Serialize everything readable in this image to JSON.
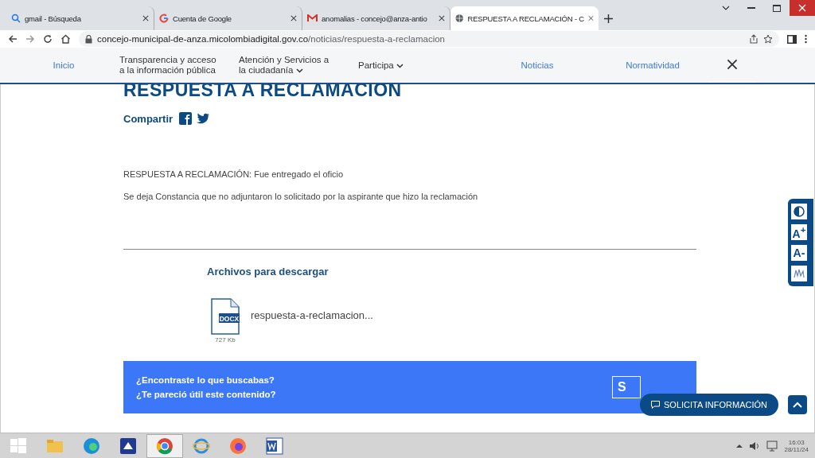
{
  "browser": {
    "tabs": [
      {
        "kind": "search",
        "title": "gmail - Búsqueda",
        "selected": false
      },
      {
        "kind": "google",
        "title": "Cuenta de Google",
        "selected": false
      },
      {
        "kind": "mail",
        "title": "anomalias - concejo@anza-antio",
        "selected": false
      },
      {
        "kind": "globe",
        "title": "RESPUESTA A RECLAMACIÓN - C",
        "selected": true
      }
    ],
    "url_host": "concejo-municipal-de-anza.micolombiadigital.gov.co",
    "url_path": "/noticias/respuesta-a-reclamacion"
  },
  "nav": {
    "items": [
      {
        "label": "Inicio",
        "dropdown": false,
        "kind": "link"
      },
      {
        "label": "Transparencia y acceso a la información pública",
        "dropdown": false,
        "kind": "plain"
      },
      {
        "label": "Atención y Servicios a la ciudadanía",
        "dropdown": true,
        "kind": "plain"
      },
      {
        "label": "Participa",
        "dropdown": true,
        "kind": "plain"
      },
      {
        "label": "Noticias",
        "dropdown": false,
        "kind": "link"
      },
      {
        "label": "Normatividad",
        "dropdown": false,
        "kind": "link"
      }
    ]
  },
  "article": {
    "title": "RESPUESTA A RECLAMACION",
    "share_label": "Compartir",
    "paragraphs": [
      "RESPUESTA A RECLAMACIÓN: Fue entregado el oficio",
      "Se deja Constancia que no adjuntaron lo solicitado por la aspirante que hizo la reclamación"
    ],
    "downloads_title": "Archivos para descargar",
    "files": [
      {
        "type": "DOCX",
        "name": "respuesta-a-reclamacion...",
        "size": "727 Kb"
      }
    ]
  },
  "feedback": {
    "lines": [
      "¿Encontraste lo que buscabas?",
      "¿Te pareció útil este contenido?"
    ],
    "buttons": [
      "S"
    ]
  },
  "accessibility": {
    "tools": [
      {
        "kind": "contrast"
      },
      {
        "kind": "text",
        "label": "A$^{+}$"
      },
      {
        "kind": "text",
        "label": "A-"
      },
      {
        "kind": "sign"
      }
    ]
  },
  "floating": {
    "request_label": "SOLICITA INFORMACIÓN"
  },
  "taskbar": {
    "apps": [
      {
        "kind": "folder",
        "selected": false
      },
      {
        "kind": "edge",
        "selected": false
      },
      {
        "kind": "scanner",
        "selected": false
      },
      {
        "kind": "chrome",
        "selected": true
      },
      {
        "kind": "ie",
        "selected": false
      },
      {
        "kind": "firefox",
        "selected": false
      },
      {
        "kind": "word",
        "selected": false
      }
    ],
    "time": "16:03",
    "date": "28/11/24"
  }
}
